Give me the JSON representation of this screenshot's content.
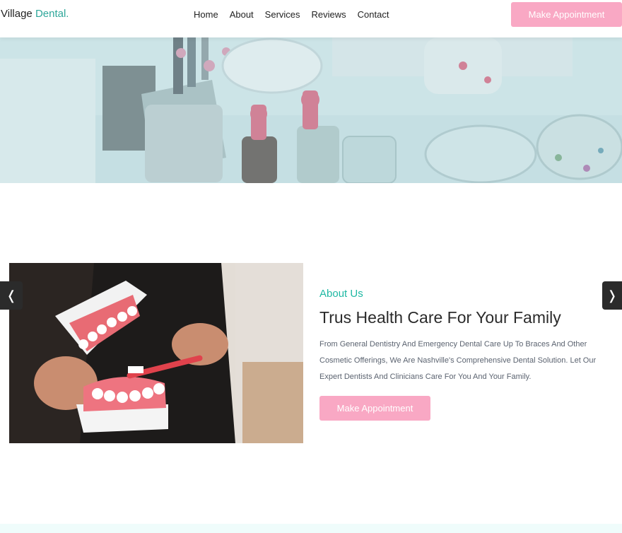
{
  "header": {
    "logo_main": "Village ",
    "logo_accent": "Dental.",
    "nav": [
      "Home",
      "About",
      "Services",
      "Reviews",
      "Contact"
    ],
    "cta_label": "Make Appointment"
  },
  "about": {
    "label": "About Us",
    "title": "Trus Health Care For Your Family",
    "text": "From General Dentistry And Emergency Dental Care Up To Braces And Other Cosmetic Offerings, We Are Nashville's Comprehensive Dental Solution. Let Our Expert Dentists And Clinicians Care For You And Your Family.",
    "cta_label": "Make Appointment",
    "prev_arrow": "❬",
    "next_arrow": "❭"
  },
  "colors": {
    "accent_teal": "#2ea79a",
    "button_pink": "#f9a8c4",
    "label_teal": "#1fb8a3"
  }
}
